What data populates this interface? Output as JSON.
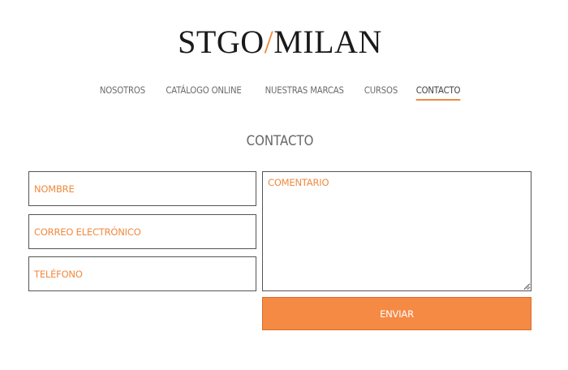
{
  "logo": {
    "part1": "STGO",
    "slash": "/",
    "part2": "MILAN"
  },
  "nav": {
    "items": [
      {
        "label": "NOSOTROS"
      },
      {
        "label": "CATÁLOGO ONLINE"
      },
      {
        "label": "NUESTRAS MARCAS"
      },
      {
        "label": "CURSOS"
      },
      {
        "label": "CONTACTO",
        "active": true
      }
    ]
  },
  "page": {
    "title": "CONTACTO"
  },
  "form": {
    "name_placeholder": "NOMBRE",
    "email_placeholder": "CORREO ELECTRÓNICO",
    "phone_placeholder": "TELÉFONO",
    "comment_placeholder": "COMENTARIO",
    "submit_label": "ENVIAR"
  },
  "colors": {
    "accent": "#f08a3f",
    "button": "#f58a45",
    "text": "#6c6c6c",
    "border": "#555555"
  }
}
